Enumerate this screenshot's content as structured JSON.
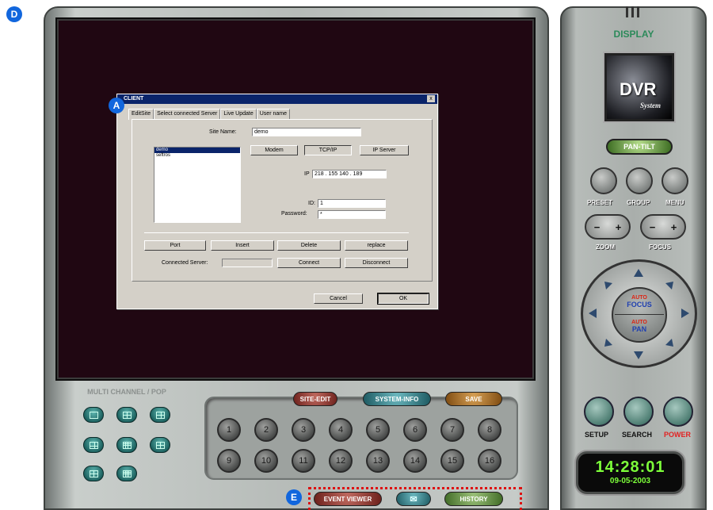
{
  "badges": {
    "a": "A",
    "d": "D",
    "e": "E"
  },
  "dialog": {
    "title": "CLIENT",
    "close": "x",
    "tabs": [
      "EditSite",
      "Select connected Server",
      "Live Update",
      "User name"
    ],
    "site_name_label": "Site Name:",
    "site_name_value": "demo",
    "sites": [
      "demo",
      "seftros"
    ],
    "conn_buttons": [
      "Modem",
      "TCP/IP",
      "IP Server"
    ],
    "ip_label": "IP",
    "ip_value": "218 . 155   140 . 189",
    "id_label": "ID:",
    "id_value": "1",
    "password_label": "Password:",
    "password_value": "*",
    "row_buttons": [
      "Port",
      "Insert",
      "Delete",
      "replace"
    ],
    "connected_server_label": "Connected Server:",
    "connect": "Connect",
    "disconnect": "Disconnect",
    "cancel": "Cancel",
    "ok": "OK"
  },
  "bottom": {
    "multi_channel_label": "MULTI CHANNEL / POP",
    "site_edit": "SITE-EDIT",
    "system_info": "SYSTEM-INFO",
    "save": "SAVE",
    "channels": [
      "1",
      "2",
      "3",
      "4",
      "5",
      "6",
      "7",
      "8",
      "9",
      "10",
      "11",
      "12",
      "13",
      "14",
      "15",
      "16"
    ],
    "event_viewer": "EVENT VIEWER",
    "history": "HISTORY"
  },
  "side": {
    "display": "DISPLAY",
    "logo_main": "DVR",
    "logo_sub": "System",
    "pan_tilt": "PAN-TILT",
    "preset": "PRESET",
    "group": "GROUP",
    "menu": "MENU",
    "zoom": "ZOOM",
    "focus": "FOCUS",
    "minus": "−",
    "plus": "+",
    "auto1": "AUTO",
    "focus_txt": "FOCUS",
    "auto2": "AUTO",
    "pan_txt": "PAN",
    "setup": "SETUP",
    "search": "SEARCH",
    "power": "POWER",
    "time": "14:28:01",
    "date": "09-05-2003"
  },
  "colors": {
    "screen": "#200712",
    "title_bar": "#0a246a",
    "clock_text": "#7dff3a",
    "power": "#e22222",
    "badge": "#1166dd"
  }
}
